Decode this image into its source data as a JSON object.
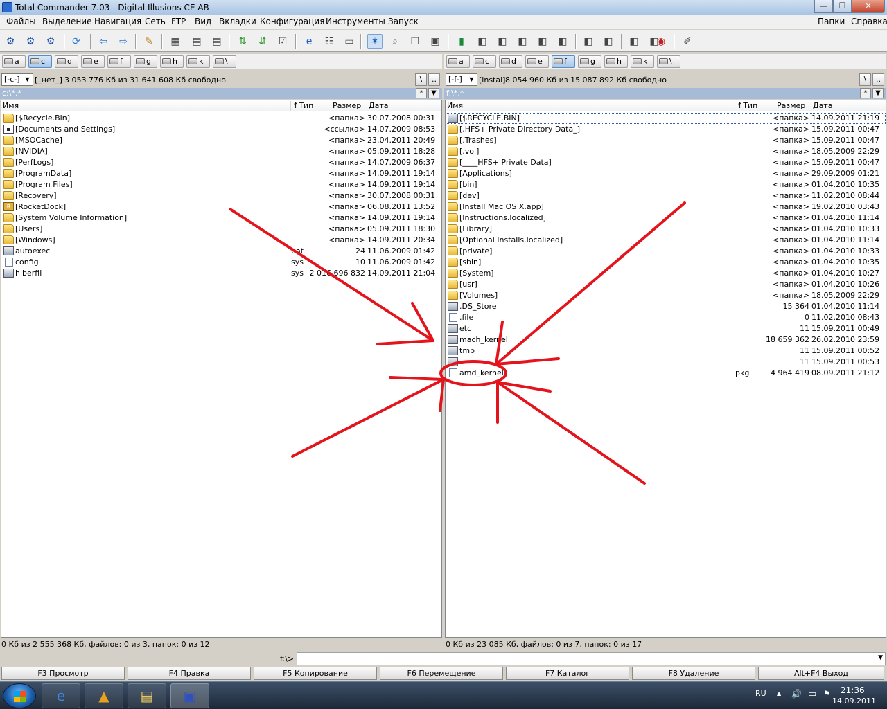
{
  "window": {
    "title": "Total Commander 7.03 - Digital Illusions CE AB",
    "min_glyph": "—",
    "max_glyph": "❐",
    "close_glyph": "✕"
  },
  "menu": {
    "left": [
      "Файлы",
      "Выделение",
      "Навигация",
      "Сеть",
      "FTP",
      "Вид",
      "Вкладки",
      "Конфигурация",
      "Инструменты",
      "Запуск"
    ],
    "right": [
      "Папки",
      "Справка"
    ]
  },
  "toolbar_icons": [
    "gear-icon",
    "gear-icon",
    "gear-icon",
    "refresh-icon",
    "back-icon",
    "forward-icon",
    "wrench-icon",
    "7z-icon",
    "archive-icon",
    "archive-icon",
    "sync-icon",
    "sort-icon",
    "checklist-icon",
    "ie-icon",
    "compare-icon",
    "notepad-icon",
    "star-icon",
    "search-icon",
    "copy-icon",
    "window-icon",
    "book-icon",
    "tool-icon",
    "tool-icon",
    "tool-icon",
    "tool-icon",
    "tool-icon",
    "tool-icon",
    "tool-icon",
    "tool-icon",
    "tool-icon",
    "paint-icon",
    "brush-icon"
  ],
  "left": {
    "drives": [
      {
        "label": "a",
        "active": false
      },
      {
        "label": "c",
        "active": true
      },
      {
        "label": "d",
        "active": false
      },
      {
        "label": "e",
        "active": false
      },
      {
        "label": "f",
        "active": false
      },
      {
        "label": "g",
        "active": false
      },
      {
        "label": "h",
        "active": false
      },
      {
        "label": "k",
        "active": false
      },
      {
        "label": "\\",
        "active": false
      }
    ],
    "drive_combo": "[-c-]",
    "volume_label": "[_нет_]",
    "free_info": "3 053 776 Кб из 31 641 608 Кб свободно",
    "root_btn": "\\",
    "up_btn": "..",
    "path": "c:\\*.*",
    "star_btn": "*",
    "down_btn": "▼",
    "columns": {
      "name": "Имя",
      "type": "↑Тип",
      "size": "Размер",
      "date": "Дата"
    },
    "files": [
      {
        "icon": "folder",
        "name": "[$Recycle.Bin]",
        "type": "",
        "size": "<папка>",
        "date": "30.07.2008 00:31"
      },
      {
        "icon": "link",
        "name": "[Documents and Settings]",
        "type": "",
        "size": "<ссылка>",
        "date": "14.07.2009 08:53"
      },
      {
        "icon": "folder",
        "name": "[MSOCache]",
        "type": "",
        "size": "<папка>",
        "date": "23.04.2011 20:49"
      },
      {
        "icon": "folder",
        "name": "[NVIDIA]",
        "type": "",
        "size": "<папка>",
        "date": "05.09.2011 18:28"
      },
      {
        "icon": "folder",
        "name": "[PerfLogs]",
        "type": "",
        "size": "<папка>",
        "date": "14.07.2009 06:37"
      },
      {
        "icon": "folder",
        "name": "[ProgramData]",
        "type": "",
        "size": "<папка>",
        "date": "14.09.2011 19:14"
      },
      {
        "icon": "folder",
        "name": "[Program Files]",
        "type": "",
        "size": "<папка>",
        "date": "14.09.2011 19:14"
      },
      {
        "icon": "folder",
        "name": "[Recovery]",
        "type": "",
        "size": "<папка>",
        "date": "30.07.2008 00:31"
      },
      {
        "icon": "rocket",
        "name": "[RocketDock]",
        "type": "",
        "size": "<папка>",
        "date": "06.08.2011 13:52"
      },
      {
        "icon": "folder",
        "name": "[System Volume Information]",
        "type": "",
        "size": "<папка>",
        "date": "14.09.2011 19:14"
      },
      {
        "icon": "folder",
        "name": "[Users]",
        "type": "",
        "size": "<папка>",
        "date": "05.09.2011 18:30"
      },
      {
        "icon": "folder",
        "name": "[Windows]",
        "type": "",
        "size": "<папка>",
        "date": "14.09.2011 20:34"
      },
      {
        "icon": "exe",
        "name": "autoexec",
        "type": "bat",
        "size": "24",
        "date": "11.06.2009 01:42"
      },
      {
        "icon": "file",
        "name": "config",
        "type": "sys",
        "size": "10",
        "date": "11.06.2009 01:42"
      },
      {
        "icon": "exe",
        "name": "hiberfil",
        "type": "sys",
        "size": "2 016 696 832",
        "date": "14.09.2011 21:04"
      }
    ],
    "status": "0 Кб из 2 555 368 Кб, файлов: 0 из 3, папок: 0 из 12"
  },
  "right": {
    "drives": [
      {
        "label": "a",
        "active": false
      },
      {
        "label": "c",
        "active": false
      },
      {
        "label": "d",
        "active": false
      },
      {
        "label": "e",
        "active": false
      },
      {
        "label": "f",
        "active": true
      },
      {
        "label": "g",
        "active": false
      },
      {
        "label": "h",
        "active": false
      },
      {
        "label": "k",
        "active": false
      },
      {
        "label": "\\",
        "active": false
      }
    ],
    "drive_combo": "[-f-]",
    "volume_label": "[instal]",
    "free_info": "8 054 960 Кб из 15 087 892 Кб свободно",
    "root_btn": "\\",
    "up_btn": "..",
    "path": "f:\\*.*",
    "star_btn": "*",
    "down_btn": "▼",
    "columns": {
      "name": "Имя",
      "type": "↑Тип",
      "size": "Размер",
      "date": "Дата"
    },
    "files": [
      {
        "icon": "exe",
        "name": "[$RECYCLE.BIN]",
        "type": "",
        "size": "<папка>",
        "date": "14.09.2011 21:19"
      },
      {
        "icon": "folder",
        "name": "[.HFS+ Private Directory Data_]",
        "type": "",
        "size": "<папка>",
        "date": "15.09.2011 00:47"
      },
      {
        "icon": "folder",
        "name": "[.Trashes]",
        "type": "",
        "size": "<папка>",
        "date": "15.09.2011 00:47"
      },
      {
        "icon": "folder",
        "name": "[.vol]",
        "type": "",
        "size": "<папка>",
        "date": "18.05.2009 22:29"
      },
      {
        "icon": "folder",
        "name": "[____HFS+ Private Data]",
        "type": "",
        "size": "<папка>",
        "date": "15.09.2011 00:47"
      },
      {
        "icon": "folder",
        "name": "[Applications]",
        "type": "",
        "size": "<папка>",
        "date": "29.09.2009 01:21"
      },
      {
        "icon": "folder",
        "name": "[bin]",
        "type": "",
        "size": "<папка>",
        "date": "01.04.2010 10:35"
      },
      {
        "icon": "folder",
        "name": "[dev]",
        "type": "",
        "size": "<папка>",
        "date": "11.02.2010 08:44"
      },
      {
        "icon": "folder",
        "name": "[Install Mac OS X.app]",
        "type": "",
        "size": "<папка>",
        "date": "19.02.2010 03:43"
      },
      {
        "icon": "folder",
        "name": "[Instructions.localized]",
        "type": "",
        "size": "<папка>",
        "date": "01.04.2010 11:14"
      },
      {
        "icon": "folder",
        "name": "[Library]",
        "type": "",
        "size": "<папка>",
        "date": "01.04.2010 10:33"
      },
      {
        "icon": "folder",
        "name": "[Optional Installs.localized]",
        "type": "",
        "size": "<папка>",
        "date": "01.04.2010 11:14"
      },
      {
        "icon": "folder",
        "name": "[private]",
        "type": "",
        "size": "<папка>",
        "date": "01.04.2010 10:33"
      },
      {
        "icon": "folder",
        "name": "[sbin]",
        "type": "",
        "size": "<папка>",
        "date": "01.04.2010 10:35"
      },
      {
        "icon": "folder",
        "name": "[System]",
        "type": "",
        "size": "<папка>",
        "date": "01.04.2010 10:27"
      },
      {
        "icon": "folder",
        "name": "[usr]",
        "type": "",
        "size": "<папка>",
        "date": "01.04.2010 10:26"
      },
      {
        "icon": "folder",
        "name": "[Volumes]",
        "type": "",
        "size": "<папка>",
        "date": "18.05.2009 22:29"
      },
      {
        "icon": "exe",
        "name": ".DS_Store",
        "type": "",
        "size": "15 364",
        "date": "01.04.2010 11:14"
      },
      {
        "icon": "file",
        "name": ".file",
        "type": "",
        "size": "0",
        "date": "11.02.2010 08:43"
      },
      {
        "icon": "exe",
        "name": "etc",
        "type": "",
        "size": "11",
        "date": "15.09.2011 00:49"
      },
      {
        "icon": "exe",
        "name": "mach_kernel",
        "type": "",
        "size": "18 659 362",
        "date": "26.02.2010 23:59"
      },
      {
        "icon": "exe",
        "name": "tmp",
        "type": "",
        "size": "11",
        "date": "15.09.2011 00:52"
      },
      {
        "icon": "exe",
        "name": "",
        "type": "",
        "size": "11",
        "date": "15.09.2011 00:53"
      },
      {
        "icon": "file",
        "name": "amd_kernel",
        "type": "pkg",
        "size": "4 964 419",
        "date": "08.09.2011 21:12"
      }
    ],
    "status": "0 Кб из 23 085 Кб, файлов: 0 из 7, папок: 0 из 17"
  },
  "cmdline": {
    "label": "f:\\>",
    "value": "",
    "arrow": "▼"
  },
  "fkeys": [
    "F3 Просмотр",
    "F4 Правка",
    "F5 Копирование",
    "F6 Перемещение",
    "F7 Каталог",
    "F8 Удаление",
    "Alt+F4 Выход"
  ],
  "taskbar": {
    "apps": [
      {
        "icon": "ie-icon",
        "glyph": "e",
        "active": false
      },
      {
        "icon": "aimp-icon",
        "glyph": "▲",
        "active": false
      },
      {
        "icon": "explorer-icon",
        "glyph": "▤",
        "active": false
      },
      {
        "icon": "floppy-icon",
        "glyph": "▣",
        "active": true
      }
    ],
    "lang": "RU",
    "tray_arrow": "▲",
    "volume_glyph": "🔊",
    "network_glyph": "▭",
    "flag_glyph": "⚑",
    "time": "21:36",
    "date": "14.09.2011"
  },
  "colors": {
    "annotation": "#e3141b",
    "path_bar": "#a6bcd6"
  }
}
